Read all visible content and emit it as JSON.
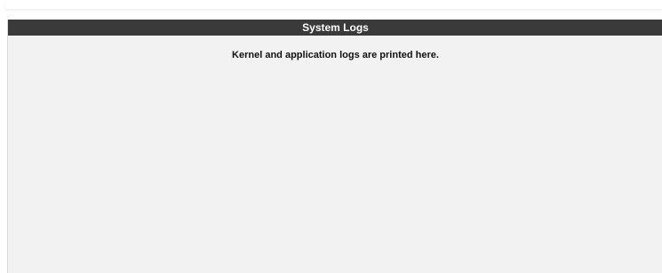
{
  "panel": {
    "title": "System Logs",
    "message": "Kernel and application logs are printed here."
  },
  "colors": {
    "header_bg": "#3a3a3a",
    "header_text": "#ffffff",
    "panel_bg": "#f2f2f2",
    "message_text": "#111111"
  }
}
